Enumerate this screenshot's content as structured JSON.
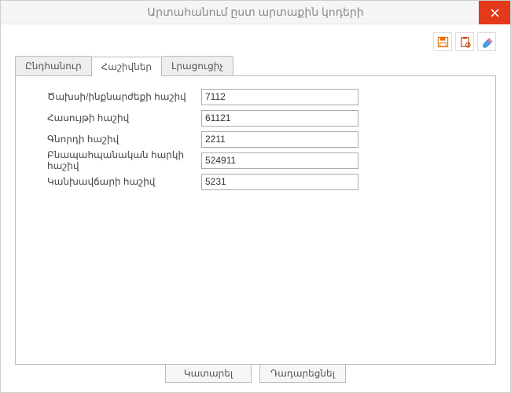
{
  "title": "Արտահանում ըստ արտաքին կոդերի",
  "toolbar": {
    "save_icon": "save",
    "clipboard_icon": "clipboard",
    "erase_icon": "erase"
  },
  "tabs": [
    {
      "label": "Ընդհանուր",
      "active": false
    },
    {
      "label": "Հաշիվներ",
      "active": true
    },
    {
      "label": "Լրացուցիչ",
      "active": false
    }
  ],
  "form": {
    "rows": [
      {
        "label": "Ծախսի/ինքնարժեքի հաշիվ",
        "value": "7112"
      },
      {
        "label": "Հասույթի հաշիվ",
        "value": "61121"
      },
      {
        "label": "Գնորդի հաշիվ",
        "value": "2211"
      },
      {
        "label": "Բնապահպանական հարկի հաշիվ",
        "value": "524911"
      },
      {
        "label": "Կանխավճարի հաշիվ",
        "value": "5231"
      }
    ]
  },
  "footer": {
    "ok": "Կատարել",
    "cancel": "Դադարեցնել"
  }
}
